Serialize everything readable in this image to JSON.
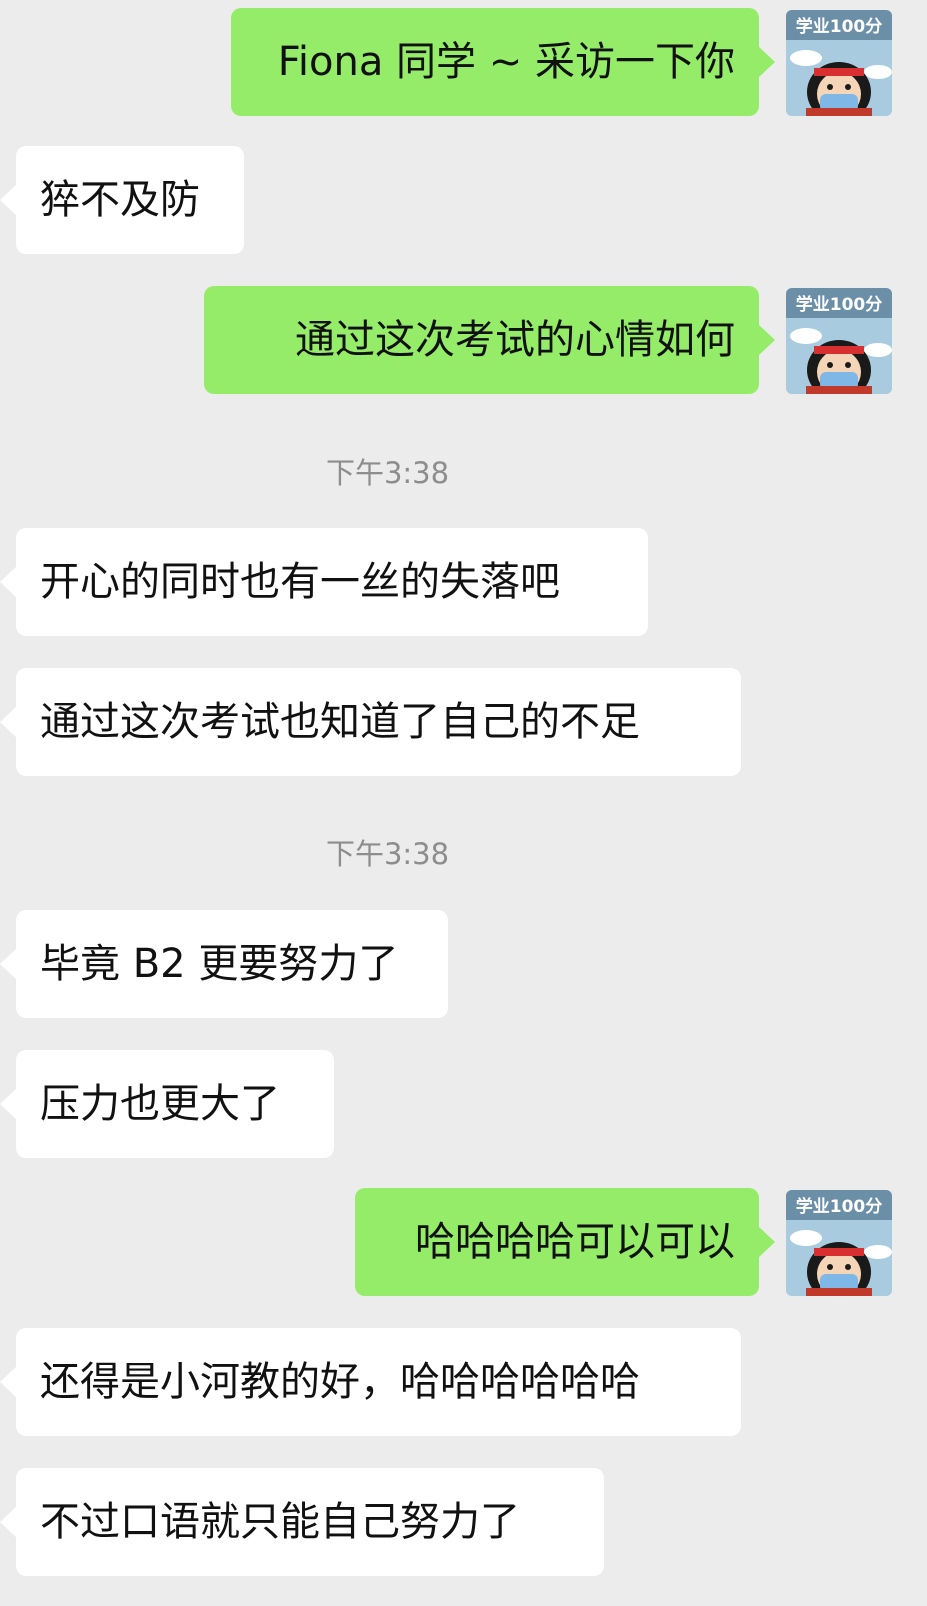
{
  "messages": [
    {
      "side": "right",
      "text": "Fiona 同学 ~ 采访一下你"
    },
    {
      "side": "left",
      "text": "猝不及防"
    },
    {
      "side": "right",
      "text": "通过这次考试的心情如何"
    },
    {
      "side": "time",
      "text": "下午3:38"
    },
    {
      "side": "left",
      "text": "开心的同时也有一丝的失落吧"
    },
    {
      "side": "left",
      "text": "通过这次考试也知道了自己的不足"
    },
    {
      "side": "time",
      "text": "下午3:38"
    },
    {
      "side": "left",
      "text": "毕竟 B2 更要努力了"
    },
    {
      "side": "left",
      "text": "压力也更大了"
    },
    {
      "side": "right",
      "text": "哈哈哈哈可以可以"
    },
    {
      "side": "left",
      "text": "还得是小河教的好，哈哈哈哈哈哈"
    },
    {
      "side": "left",
      "text": "不过口语就只能自己努力了"
    }
  ],
  "avatar": {
    "banner_text": "学业100分",
    "icon": "cartoon-student-avatar-icon"
  },
  "colors": {
    "background": "#ececec",
    "sent_bubble": "#95ec69",
    "received_bubble": "#ffffff",
    "timestamp_text": "#8d8d8d"
  }
}
